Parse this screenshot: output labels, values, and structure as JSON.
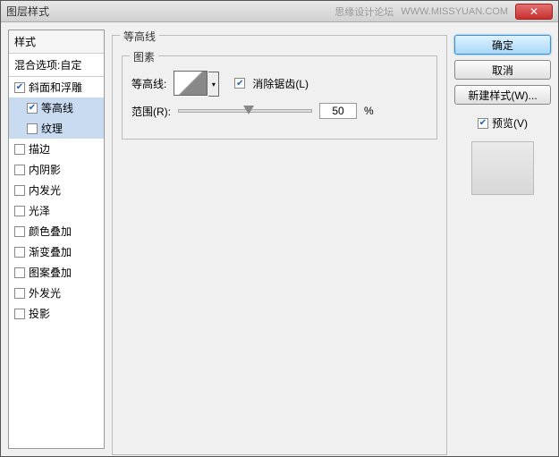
{
  "dialog": {
    "title": "图层样式",
    "watermark1": "思缘设计论坛",
    "watermark2": "WWW.MISSYUAN.COM"
  },
  "left": {
    "header": "样式",
    "blend": "混合选项:自定",
    "items": [
      {
        "label": "斜面和浮雕",
        "checked": true,
        "sub": false,
        "selected": false
      },
      {
        "label": "等高线",
        "checked": true,
        "sub": true,
        "selected": true
      },
      {
        "label": "纹理",
        "checked": false,
        "sub": true,
        "selected": true
      },
      {
        "label": "描边",
        "checked": false,
        "sub": false,
        "selected": false
      },
      {
        "label": "内阴影",
        "checked": false,
        "sub": false,
        "selected": false
      },
      {
        "label": "内发光",
        "checked": false,
        "sub": false,
        "selected": false
      },
      {
        "label": "光泽",
        "checked": false,
        "sub": false,
        "selected": false
      },
      {
        "label": "颜色叠加",
        "checked": false,
        "sub": false,
        "selected": false
      },
      {
        "label": "渐变叠加",
        "checked": false,
        "sub": false,
        "selected": false
      },
      {
        "label": "图案叠加",
        "checked": false,
        "sub": false,
        "selected": false
      },
      {
        "label": "外发光",
        "checked": false,
        "sub": false,
        "selected": false
      },
      {
        "label": "投影",
        "checked": false,
        "sub": false,
        "selected": false
      }
    ]
  },
  "main": {
    "outer_legend": "等高线",
    "inner_legend": "图素",
    "contour_label": "等高线:",
    "antialias_label": "消除锯齿(L)",
    "antialias_checked": true,
    "range_label": "范围(R):",
    "range_value": "50",
    "percent": "%"
  },
  "right": {
    "ok": "确定",
    "cancel": "取消",
    "newstyle": "新建样式(W)...",
    "preview_label": "预览(V)",
    "preview_checked": true
  }
}
